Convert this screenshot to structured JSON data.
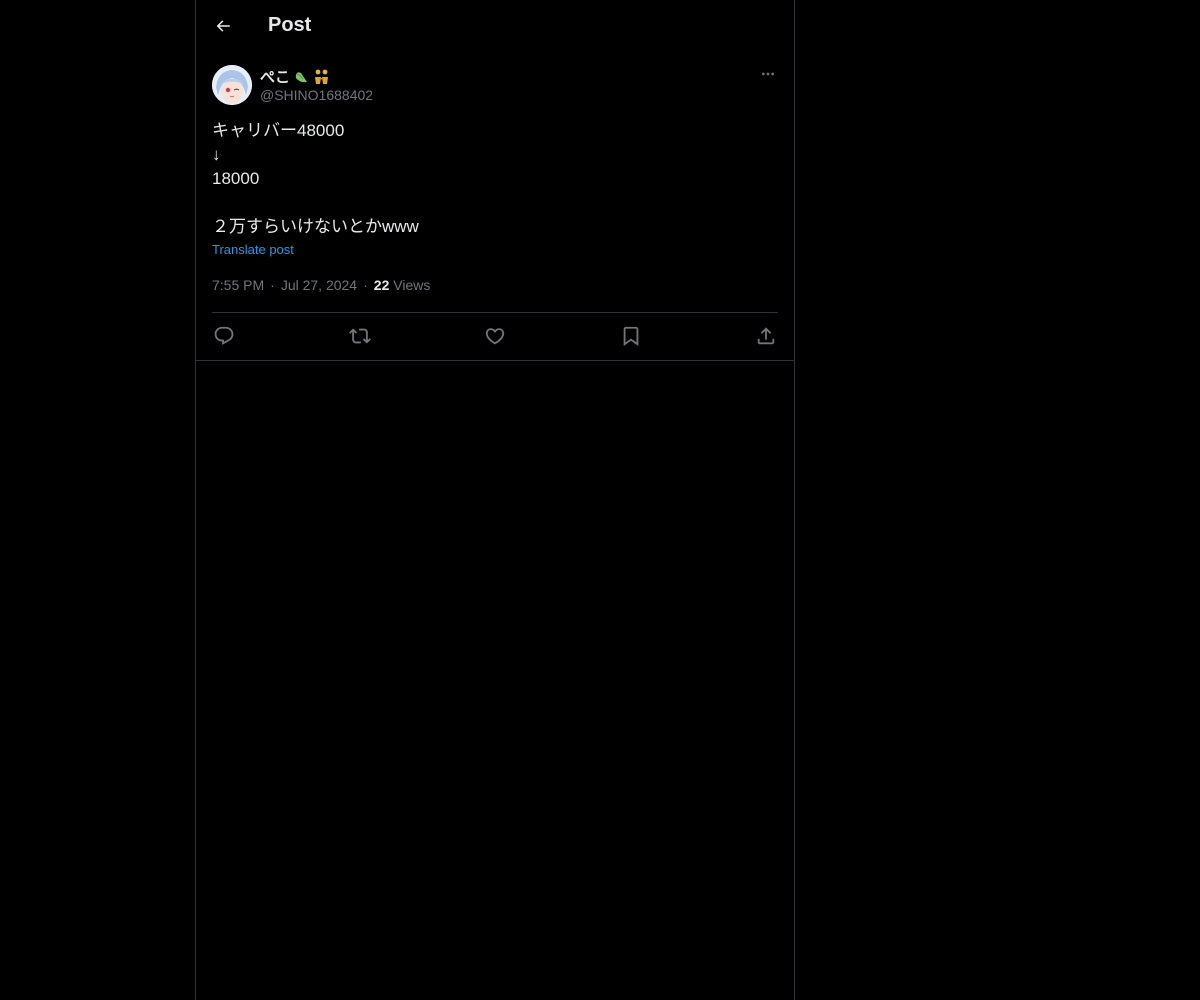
{
  "header": {
    "title": "Post"
  },
  "post": {
    "author": {
      "display_name": "ぺこ",
      "handle": "@SHINO1688402",
      "name_emojis": [
        "carrot-emoji",
        "two-people-emoji"
      ]
    },
    "text": "キャリバー48000\n↓\n18000\n\n２万すらいけないとかwww",
    "translate_label": "Translate post",
    "time": "7:55 PM",
    "date": "Jul 27, 2024",
    "views_count": "22",
    "views_label": "Views"
  },
  "actions": [
    "reply-icon",
    "repost-icon",
    "like-icon",
    "bookmark-icon",
    "share-icon"
  ],
  "colors": {
    "background": "#000000",
    "text": "#e7e9ea",
    "muted": "#71767b",
    "link": "#1d9bf0",
    "border": "#2f3336"
  }
}
